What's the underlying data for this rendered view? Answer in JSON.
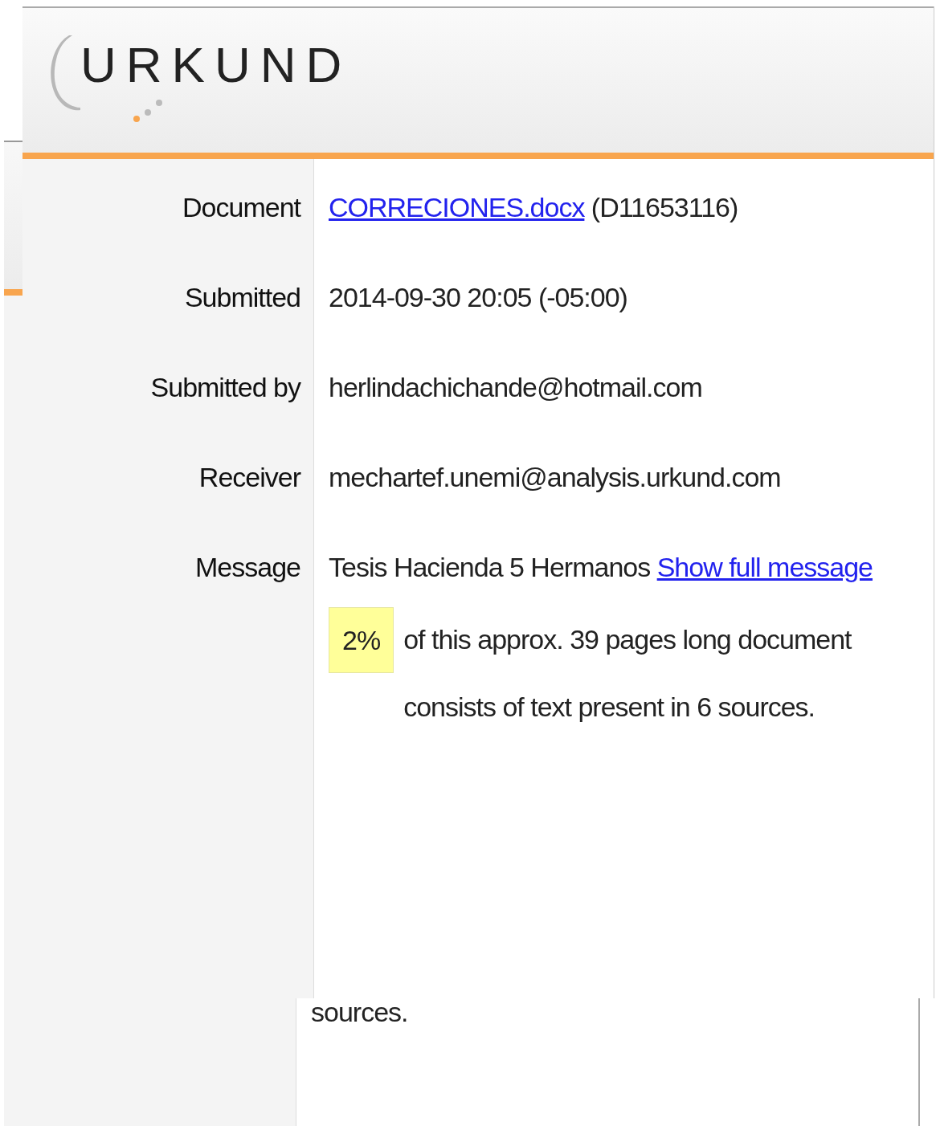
{
  "header": {
    "logo": "URKUND"
  },
  "details": [
    {
      "label": "Document",
      "parts": [
        {
          "text": "CORRECIONES.docx",
          "link": true
        },
        {
          "text": "(D11653116)",
          "link": false
        }
      ]
    },
    {
      "label": "Submitted",
      "parts": [
        {
          "text": "2014-09-30 20:05 (-05:00)",
          "link": false
        }
      ]
    },
    {
      "label": "Submitted by",
      "parts": [
        {
          "text": "herlindachichande@hotmail.com",
          "link": false
        }
      ]
    },
    {
      "label": "Receiver",
      "parts": [
        {
          "text": "mechartef.unemi@analysis.urkund.com",
          "link": false
        }
      ]
    },
    {
      "label": "Message",
      "parts": [
        {
          "text": "Tesis Hacienda 5 Hermanos",
          "link": false
        },
        {
          "text": "Show full message",
          "link": true
        }
      ]
    }
  ],
  "summary": {
    "percent": "2%",
    "text": "of this approx. 39 pages long document consists of text present in 6 sources."
  },
  "background_layer": {
    "text": "sources."
  }
}
